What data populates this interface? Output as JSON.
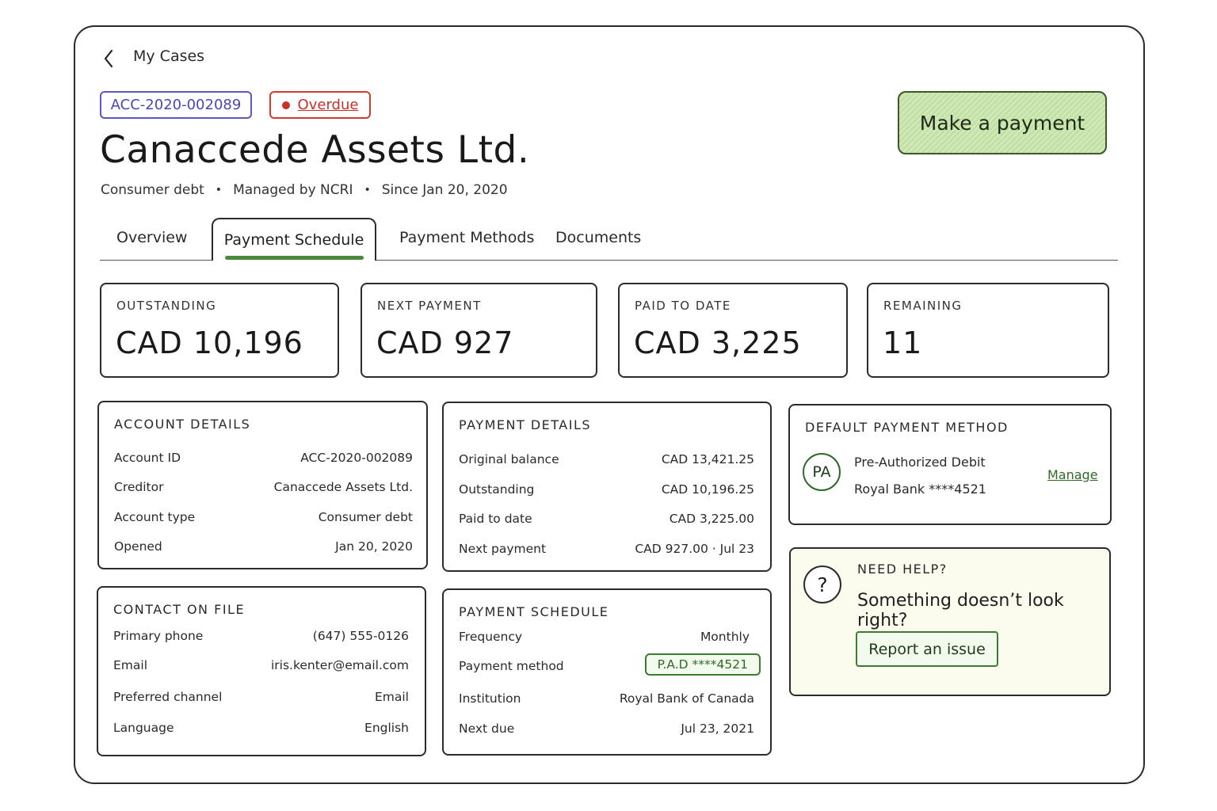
{
  "breadcrumb": {
    "label": "My Cases"
  },
  "account_badge": "ACC-2020-002089",
  "status_badge": "Overdue",
  "title": "Canaccede Assets Ltd.",
  "meta": {
    "type": "Consumer debt",
    "manager": "Managed by NCRI",
    "since": "Since Jan 20, 2020"
  },
  "primary_action": "Make a payment",
  "tabs": [
    {
      "label": "Overview",
      "active": false
    },
    {
      "label": "Payment Schedule",
      "active": true
    },
    {
      "label": "Payment Methods",
      "active": false
    },
    {
      "label": "Documents",
      "active": false
    }
  ],
  "stats": [
    {
      "label": "OUTSTANDING",
      "value": "CAD 10,196"
    },
    {
      "label": "NEXT PAYMENT",
      "value": "CAD 927"
    },
    {
      "label": "PAID TO DATE",
      "value": "CAD 3,225"
    },
    {
      "label": "REMAINING",
      "value": "11"
    }
  ],
  "account_details": {
    "heading": "ACCOUNT DETAILS",
    "rows": [
      {
        "label": "Account ID",
        "value": "ACC-2020-002089"
      },
      {
        "label": "Creditor",
        "value": "Canaccede Assets Ltd."
      },
      {
        "label": "Account type",
        "value": "Consumer debt"
      },
      {
        "label": "Opened",
        "value": "Jan 20, 2020"
      }
    ]
  },
  "payment_details": {
    "heading": "PAYMENT DETAILS",
    "rows": [
      {
        "label": "Original balance",
        "value": "CAD 13,421.25"
      },
      {
        "label": "Outstanding",
        "value": "CAD 10,196.25"
      },
      {
        "label": "Paid to date",
        "value": "CAD 3,225.00"
      },
      {
        "label": "Next payment",
        "value": "CAD 927.00 · Jul 23"
      }
    ]
  },
  "default_method": {
    "heading": "DEFAULT PAYMENT METHOD",
    "avatar": "PA",
    "line1": "Pre-Authorized Debit",
    "line2": "Royal Bank ****4521",
    "action": "Manage"
  },
  "contact": {
    "heading": "CONTACT ON FILE",
    "rows": [
      {
        "label": "Primary phone",
        "value": "(647) 555-0126"
      },
      {
        "label": "Email",
        "value": "iris.kenter@email.com"
      },
      {
        "label": "Preferred channel",
        "value": "Email"
      },
      {
        "label": "Language",
        "value": "English"
      }
    ]
  },
  "schedule": {
    "heading": "PAYMENT SCHEDULE",
    "rows": [
      {
        "label": "Frequency",
        "value": "Monthly"
      },
      {
        "label": "Payment method",
        "value": "P.A.D ****4521"
      },
      {
        "label": "Institution",
        "value": "Royal Bank of Canada"
      },
      {
        "label": "Next due",
        "value": "Jul 23, 2021"
      }
    ]
  },
  "help": {
    "kicker": "NEED HELP?",
    "question": "Something doesn’t look right?",
    "icon": "?",
    "action": "Report an issue"
  },
  "colors": {
    "accent_green": "#4a8a3a",
    "overdue_red": "#c8302a",
    "id_purple": "#4a46b8"
  }
}
